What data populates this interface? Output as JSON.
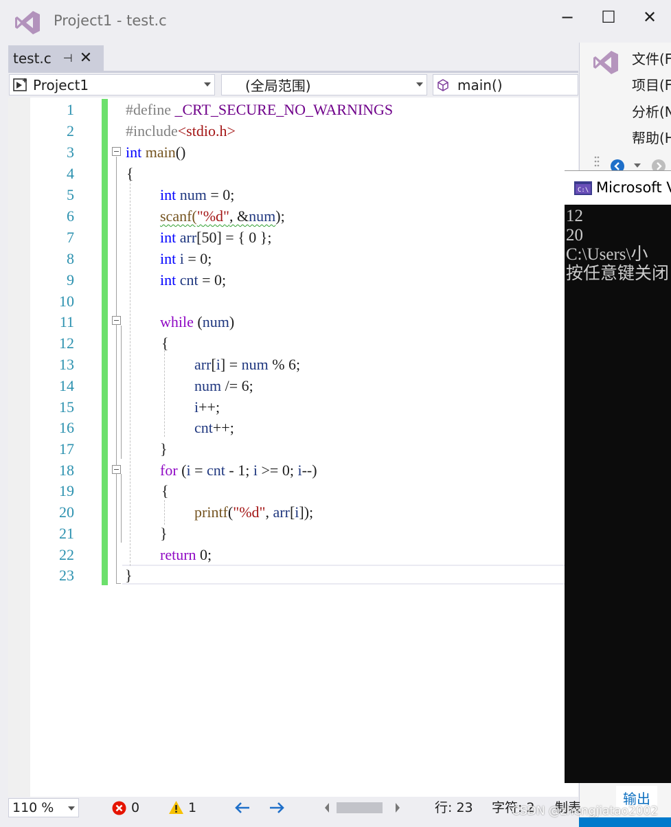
{
  "window": {
    "title": "Project1 - test.c",
    "minimize": "−",
    "maximize": "☐",
    "close": "✕"
  },
  "tab": {
    "label": "test.c",
    "pin": "⊣",
    "close": "✕"
  },
  "navbar": {
    "project": "Project1",
    "scope": "(全局范围)",
    "member": "main()"
  },
  "editor": {
    "line_numbers": [
      "1",
      "2",
      "3",
      "4",
      "5",
      "6",
      "7",
      "8",
      "9",
      "10",
      "11",
      "12",
      "13",
      "14",
      "15",
      "16",
      "17",
      "18",
      "19",
      "20",
      "21",
      "22",
      "23"
    ],
    "lines": {
      "l1": "#define",
      "l1b": "_CRT_SECURE_NO_WARNINGS",
      "l2": "#include",
      "l2b": "<stdio.h>",
      "l3a": "int",
      "l3b": "main",
      "l3c": "()",
      "l4": "{",
      "l5a": "int",
      "l5b": "num",
      "l5c": " = 0;",
      "l6a": "scanf(",
      "l6b": "\"%d\"",
      "l6c": ", &",
      "l6d": "num",
      "l6e": ");",
      "l7a": "int",
      "l7b": "arr",
      "l7c": "[50] = { 0 };",
      "l8a": "int",
      "l8b": "i",
      "l8c": " = 0;",
      "l9a": "int",
      "l9b": "cnt",
      "l9c": " = 0;",
      "l11a": "while",
      "l11b": " (",
      "l11c": "num",
      "l11d": ")",
      "l12": "{",
      "l13a": "arr",
      "l13b": "[",
      "l13c": "i",
      "l13d": "] = ",
      "l13e": "num",
      "l13f": " % 6;",
      "l14a": "num",
      "l14b": " /= 6;",
      "l15a": "i",
      "l15b": "++;",
      "l16a": "cnt",
      "l16b": "++;",
      "l17": "}",
      "l18a": "for",
      "l18b": " (",
      "l18c": "i",
      "l18d": " = ",
      "l18e": "cnt",
      "l18f": " - 1; ",
      "l18g": "i",
      "l18h": " >= 0; ",
      "l18i": "i",
      "l18j": "--)",
      "l19": "{",
      "l20a": "printf",
      "l20b": "(",
      "l20c": "\"%d\"",
      "l20d": ", ",
      "l20e": "arr",
      "l20f": "[",
      "l20g": "i",
      "l20h": "]);",
      "l21": "}",
      "l22a": "return",
      "l22b": " 0;",
      "l23": "}"
    }
  },
  "status": {
    "zoom": "110 %",
    "errors": "0",
    "warnings": "1",
    "row": "行: 23",
    "col": "字符: 2",
    "mode": "制表"
  },
  "side_menu": [
    "文件(F",
    "项目(F",
    "分析(N",
    "帮助(H"
  ],
  "console": {
    "title": "Microsoft V",
    "lines": [
      "12",
      "20",
      "C:\\Users\\小",
      "按任意键关闭"
    ]
  },
  "bottom": {
    "output_tab": "输出",
    "watermark": "CSDN @zhengjiatao2002"
  },
  "colors": {
    "accent": "#007ACC",
    "line_number": "#2B91AF",
    "keyword": "#0000FF",
    "change_bar": "#6CE06C"
  }
}
